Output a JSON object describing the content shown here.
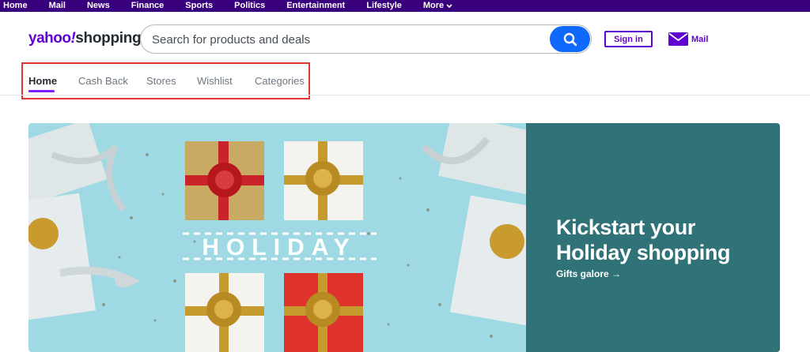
{
  "topnav": {
    "items": [
      "Home",
      "Mail",
      "News",
      "Finance",
      "Sports",
      "Politics",
      "Entertainment",
      "Lifestyle"
    ],
    "more_label": "More"
  },
  "logo": {
    "main": "yahoo",
    "bang": "!",
    "sub": "shopping"
  },
  "search": {
    "placeholder": "Search for products and deals",
    "value": ""
  },
  "header": {
    "signin_label": "Sign in",
    "mail_label": "Mail"
  },
  "tabs": [
    {
      "label": "Home",
      "active": true
    },
    {
      "label": "Cash Back",
      "active": false
    },
    {
      "label": "Stores",
      "active": false
    },
    {
      "label": "Wishlist",
      "active": false
    },
    {
      "label": "Categories",
      "active": false
    }
  ],
  "banner": {
    "image_text": "HOLIDAY",
    "headline_line1": "Kickstart your",
    "headline_line2": "Holiday shopping",
    "link_label": "Gifts galore →"
  },
  "colors": {
    "brand_purple": "#5f01d1",
    "topbar": "#39007d",
    "search_button": "#0f69ff",
    "banner_teal": "#2f7277",
    "banner_sky": "#9fd9e3",
    "highlight_box": "#e0382f"
  }
}
